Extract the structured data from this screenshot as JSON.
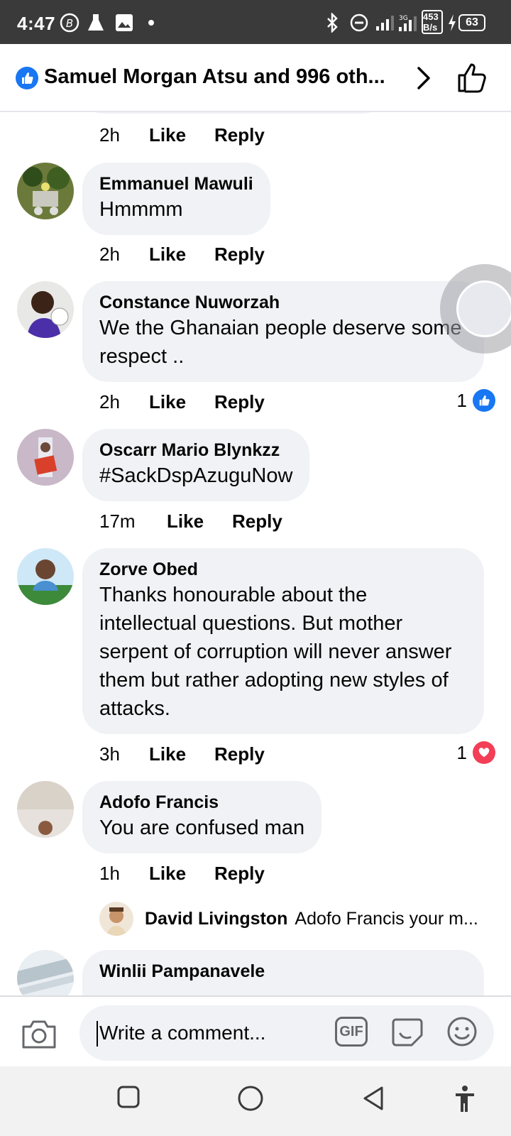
{
  "status_bar": {
    "time": "4:47",
    "speed": "453 B/s",
    "battery": "63"
  },
  "header": {
    "title": "Samuel Morgan Atsu and 996 oth..."
  },
  "labels": {
    "like": "Like",
    "reply": "Reply"
  },
  "prev_comment": {
    "time": "2h"
  },
  "comments": [
    {
      "name": "Emmanuel Mawuli",
      "text": "Hmmmm",
      "time": "2h"
    },
    {
      "name": "Constance Nuworzah",
      "text": "We the Ghanaian people deserve some respect ..",
      "time": "2h",
      "reaction_count": "1",
      "reaction": "like"
    },
    {
      "name": "Oscarr Mario Blynkzz",
      "text": "#SackDspAzuguNow",
      "time": "17m"
    },
    {
      "name": "Zorve Obed",
      "text": "Thanks honourable about the intellectual questions. But mother serpent of corruption will never answer them but rather adopting new styles of attacks.",
      "time": "3h",
      "reaction_count": "1",
      "reaction": "love"
    },
    {
      "name": "Adofo Francis",
      "text": "You are confused man",
      "time": "1h"
    },
    {
      "name": "Winlii Pampanavele"
    }
  ],
  "reply_preview": {
    "name": "David Livingston",
    "text": "Adofo Francis  your m..."
  },
  "composer": {
    "placeholder": "Write a comment...",
    "gif_label": "GIF"
  },
  "colors": {
    "accent": "#1877f2",
    "love": "#f33e58",
    "bubble": "#f0f2f5"
  }
}
